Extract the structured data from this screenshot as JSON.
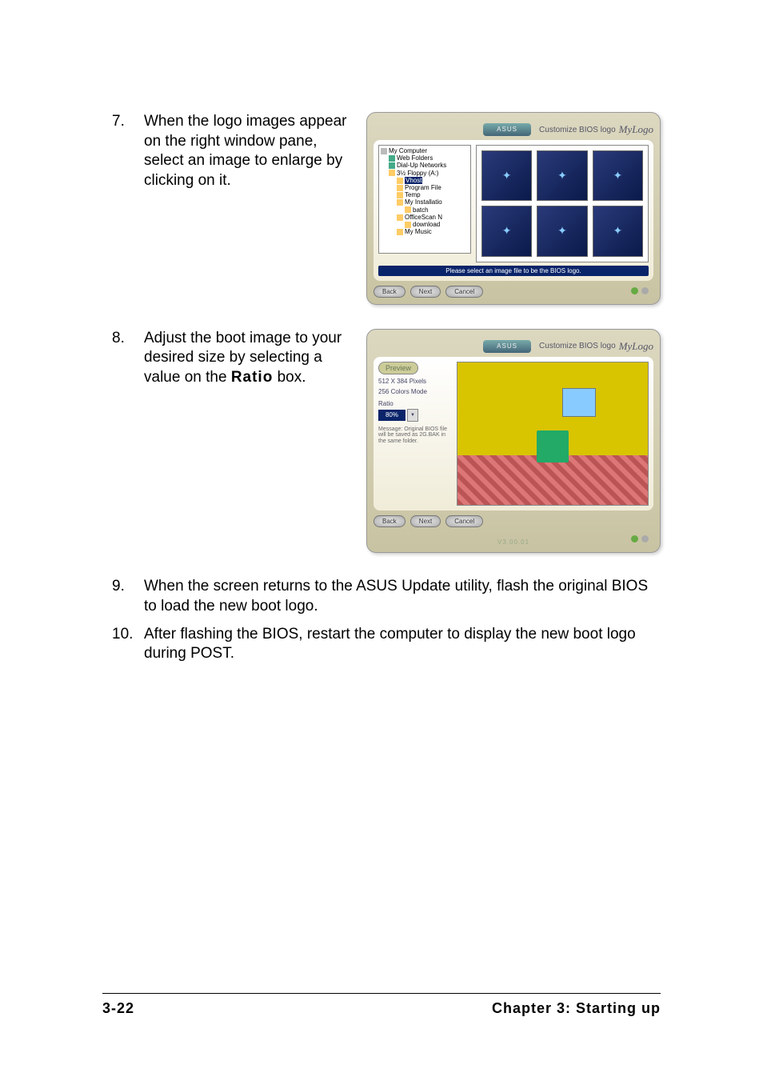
{
  "steps": {
    "s7": {
      "num": "7.",
      "text": "When the logo images appear on the right window pane, select an image to enlarge by clicking on it."
    },
    "s8": {
      "num": "8.",
      "text_a": "Adjust the boot image to your desired size by selecting a value on the ",
      "text_bold": "Ratio",
      "text_b": " box."
    },
    "s9": {
      "num": "9.",
      "text": "When the screen returns to the ASUS Update utility, flash the original BIOS to load the new boot logo."
    },
    "s10": {
      "num": "10.",
      "text": "After flashing the BIOS, restart the computer to display the new boot logo during POST."
    }
  },
  "footer": {
    "left": "3-22",
    "right": "Chapter 3: Starting up"
  },
  "shot_common": {
    "header_text": "Customize BIOS logo",
    "header_logo": "MyLogo",
    "asus": "ASUS",
    "btn_back": "Back",
    "btn_next": "Next",
    "btn_cancel": "Cancel"
  },
  "shot1": {
    "tree": {
      "root": "My Computer",
      "nodes": [
        "Web Folders",
        "Dial-Up Networks",
        "3½ Floppy (A:)",
        "Vhost",
        "Program File",
        "Temp",
        "My Installatio",
        "batch",
        "OfficeScan N",
        "download",
        "My Music"
      ],
      "selected": "Vhost"
    },
    "hint": "Please select an image file to be the BIOS logo."
  },
  "shot2": {
    "tab": "Preview",
    "res": "512 X 384 Pixels",
    "mode": "256 Colors Mode",
    "ratio_label": "Ratio",
    "ratio_value": "80%",
    "message": "Message: Original BIOS file will be saved as 2G.BAK in the same folder.",
    "version": "V3.00.01"
  }
}
